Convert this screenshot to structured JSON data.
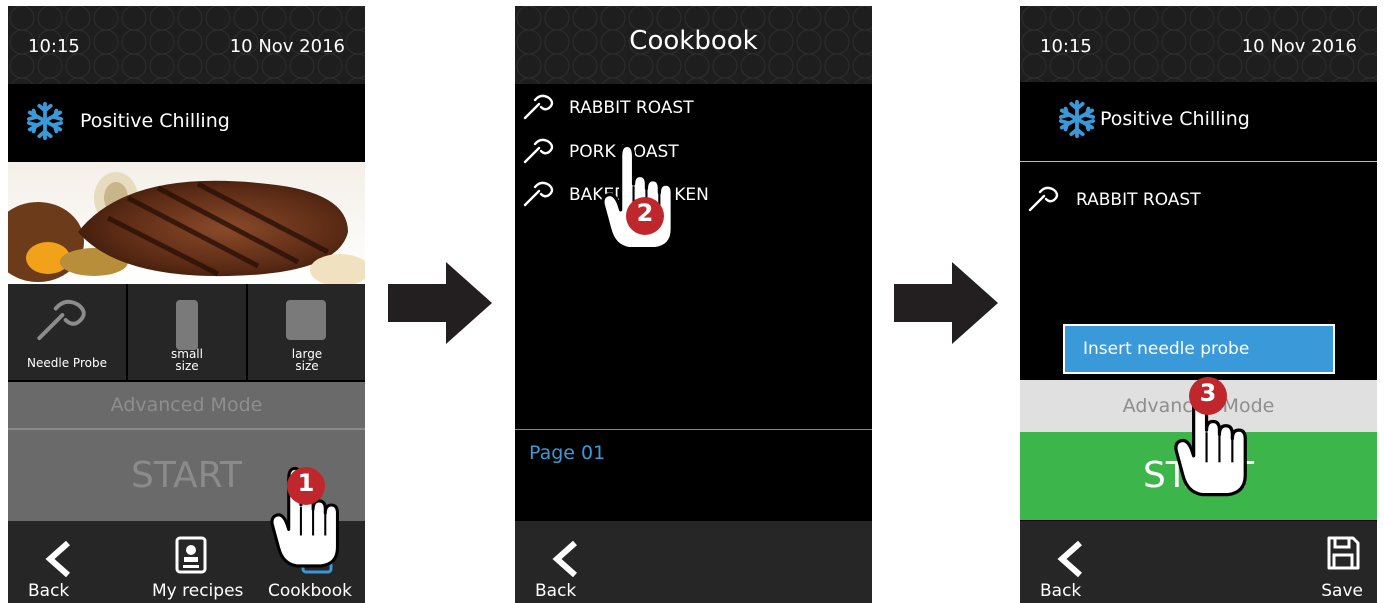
{
  "screen1": {
    "time": "10:15",
    "date": "10 Nov 2016",
    "mode": "Positive Chilling",
    "options": [
      {
        "label": "Needle Probe",
        "icon": "needle-probe-icon"
      },
      {
        "label": "small\nsize",
        "icon": "small-size-icon"
      },
      {
        "label": "large\nsize",
        "icon": "large-size-icon"
      }
    ],
    "advanced": "Advanced Mode",
    "start": "START",
    "nav": {
      "back": "Back",
      "my_recipes": "My recipes",
      "cookbook": "Cookbook"
    },
    "step": "1"
  },
  "screen2": {
    "title": "Cookbook",
    "recipes": [
      "RABBIT ROAST",
      "PORK ROAST",
      "BAKED CHICKEN"
    ],
    "page": "Page 01",
    "nav": {
      "back": "Back"
    },
    "step": "2"
  },
  "screen3": {
    "time": "10:15",
    "date": "10 Nov 2016",
    "mode": "Positive Chilling",
    "recipe": "RABBIT ROAST",
    "prompt": "Insert needle probe",
    "advanced": "Advanced Mode",
    "start": "START",
    "nav": {
      "back": "Back",
      "save": "Save"
    },
    "step": "3"
  },
  "colors": {
    "accent_blue": "#3a9ad9",
    "start_green": "#3cb54a",
    "badge_red": "#c0272d",
    "bar_dark": "#262626"
  }
}
